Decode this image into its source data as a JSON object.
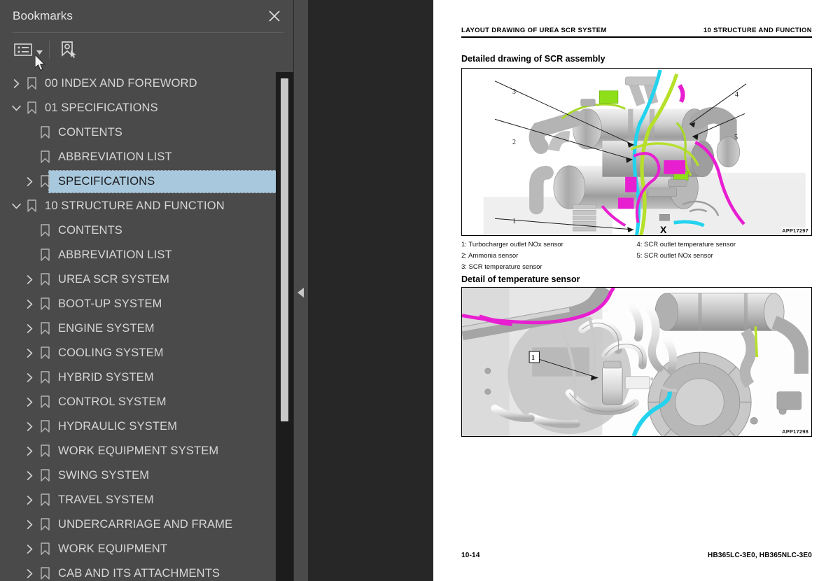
{
  "panel": {
    "title": "Bookmarks",
    "close_icon": "close-icon",
    "toolbar": {
      "listview_icon": "list-view-icon",
      "caret_icon": "chevron-down-icon",
      "new_bookmark_icon": "new-bookmark-icon"
    }
  },
  "tree": {
    "items": [
      {
        "label": "00 INDEX AND FOREWORD",
        "level": 0,
        "state": "collapsed",
        "selected": false
      },
      {
        "label": "01 SPECIFICATIONS",
        "level": 0,
        "state": "expanded",
        "selected": false
      },
      {
        "label": "CONTENTS",
        "level": 1,
        "state": "leaf",
        "selected": false
      },
      {
        "label": "ABBREVIATION LIST",
        "level": 1,
        "state": "leaf",
        "selected": false
      },
      {
        "label": "SPECIFICATIONS",
        "level": 1,
        "state": "collapsed",
        "selected": true
      },
      {
        "label": "10 STRUCTURE AND FUNCTION",
        "level": 0,
        "state": "expanded",
        "selected": false
      },
      {
        "label": "CONTENTS",
        "level": 1,
        "state": "leaf",
        "selected": false
      },
      {
        "label": "ABBREVIATION LIST",
        "level": 1,
        "state": "leaf",
        "selected": false
      },
      {
        "label": "UREA SCR SYSTEM",
        "level": 1,
        "state": "collapsed",
        "selected": false
      },
      {
        "label": "BOOT-UP SYSTEM",
        "level": 1,
        "state": "collapsed",
        "selected": false
      },
      {
        "label": "ENGINE SYSTEM",
        "level": 1,
        "state": "collapsed",
        "selected": false
      },
      {
        "label": "COOLING SYSTEM",
        "level": 1,
        "state": "collapsed",
        "selected": false
      },
      {
        "label": "HYBRID SYSTEM",
        "level": 1,
        "state": "collapsed",
        "selected": false
      },
      {
        "label": "CONTROL SYSTEM",
        "level": 1,
        "state": "collapsed",
        "selected": false
      },
      {
        "label": "HYDRAULIC SYSTEM",
        "level": 1,
        "state": "collapsed",
        "selected": false
      },
      {
        "label": "WORK EQUIPMENT SYSTEM",
        "level": 1,
        "state": "collapsed",
        "selected": false
      },
      {
        "label": "SWING SYSTEM",
        "level": 1,
        "state": "collapsed",
        "selected": false
      },
      {
        "label": "TRAVEL SYSTEM",
        "level": 1,
        "state": "collapsed",
        "selected": false
      },
      {
        "label": "UNDERCARRIAGE AND FRAME",
        "level": 1,
        "state": "collapsed",
        "selected": false
      },
      {
        "label": "WORK EQUIPMENT",
        "level": 1,
        "state": "collapsed",
        "selected": false
      },
      {
        "label": "CAB AND ITS ATTACHMENTS",
        "level": 1,
        "state": "collapsed",
        "selected": false
      }
    ]
  },
  "gutter": {
    "collapse_icon": "collapse-left-icon"
  },
  "document": {
    "header_left": "LAYOUT DRAWING OF UREA SCR SYSTEM",
    "header_right": "10 STRUCTURE AND FUNCTION",
    "section1_title": "Detailed drawing of SCR assembly",
    "figure1": {
      "id": "APP17297",
      "callouts": [
        "3",
        "4",
        "2",
        "5",
        "1"
      ],
      "marker": "X"
    },
    "legend_left": [
      "1: Turbocharger outlet NOx sensor",
      "2: Ammonia sensor",
      "3: SCR temperature sensor"
    ],
    "legend_right": [
      "4: SCR outlet temperature sensor",
      "5: SCR outlet NOx sensor"
    ],
    "section2_title": "Detail of temperature sensor",
    "figure2": {
      "id": "APP17298",
      "callouts": [
        "1"
      ]
    },
    "footer_left": "10-14",
    "footer_right": "HB365LC-3E0, HB365NLC-3E0"
  },
  "colors": {
    "panel_bg": "#4a4a4a",
    "selection": "#a8c8dd",
    "page_bg": "#ffffff",
    "gutter_bg": "#272727"
  }
}
